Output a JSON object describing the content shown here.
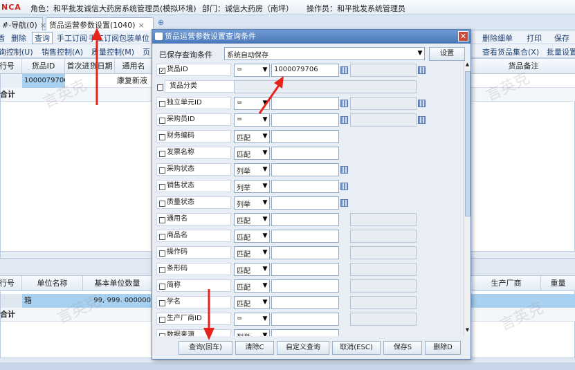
{
  "topbar": {
    "logo": "NCA",
    "role": "角色：和平批发诚信大药房系统管理员(模拟环境)",
    "dept": "部门：诚信大药房（南坪）",
    "operator": "操作员：和平批发系统管理员"
  },
  "tabs": [
    {
      "label": "#-导航(0)"
    },
    {
      "label": "货品运营参数设置(1040)"
    }
  ],
  "toolbar": {
    "items": [
      "删除",
      "查询",
      "手工订阅",
      "手工订阅包装单位",
      "删除细单",
      "打印",
      "保存"
    ]
  },
  "toolbar2": {
    "items": [
      "询控制(U)",
      "销售控制(A)",
      "质量控制(M)",
      "页",
      "查看货品集合(X)",
      "批量设置"
    ]
  },
  "grid_top": {
    "headers": [
      "行号",
      "货品ID",
      "首次进货日期",
      "通用名",
      "货品备注"
    ],
    "row": {
      "goods_id": "1000079706",
      "name": "康复新液"
    },
    "total": "合计"
  },
  "grid_bottom": {
    "headers": [
      "行号",
      "单位名称",
      "基本单位数量",
      "生产厂商",
      "重量"
    ],
    "row": {
      "unit": "箱",
      "qty": "99, 999. 000000"
    },
    "total": "合计"
  },
  "dialog": {
    "title": "货品运营参数设置查询条件",
    "saved_label": "已保存查询条件",
    "saved_value": "系统自动保存",
    "settings_btn": "设置",
    "rows": [
      {
        "label": "货品ID",
        "checked": true,
        "op": "=",
        "value": "1000079706"
      },
      {
        "label": "货品分类",
        "checked": false,
        "op": "",
        "value": ""
      },
      {
        "label": "独立单元ID",
        "checked": false,
        "op": "=",
        "value": ""
      },
      {
        "label": "采购员ID",
        "checked": false,
        "op": "=",
        "value": ""
      },
      {
        "label": "财务编码",
        "checked": false,
        "op": "匹配",
        "value": ""
      },
      {
        "label": "发票名称",
        "checked": false,
        "op": "匹配",
        "value": ""
      },
      {
        "label": "采购状态",
        "checked": false,
        "op": "列举",
        "value": ""
      },
      {
        "label": "销售状态",
        "checked": false,
        "op": "列举",
        "value": ""
      },
      {
        "label": "质量状态",
        "checked": false,
        "op": "列举",
        "value": ""
      },
      {
        "label": "通用名",
        "checked": false,
        "op": "匹配",
        "value": ""
      },
      {
        "label": "商品名",
        "checked": false,
        "op": "匹配",
        "value": ""
      },
      {
        "label": "操作码",
        "checked": false,
        "op": "匹配",
        "value": ""
      },
      {
        "label": "条形码",
        "checked": false,
        "op": "匹配",
        "value": ""
      },
      {
        "label": "简称",
        "checked": false,
        "op": "匹配",
        "value": ""
      },
      {
        "label": "学名",
        "checked": false,
        "op": "匹配",
        "value": ""
      },
      {
        "label": "生产厂商ID",
        "checked": false,
        "op": "=",
        "value": ""
      },
      {
        "label": "数据来源",
        "checked": false,
        "op": "列举",
        "value": ""
      }
    ],
    "buttons": [
      "查询(回车)",
      "清除C",
      "自定义查询",
      "取消(ESC)",
      "保存S",
      "删除D"
    ]
  },
  "watermark": "言英克",
  "colors": {
    "arrow": "#e8231b",
    "selected_row": "#a8d0f0",
    "title_bar": "#4a78b8"
  }
}
